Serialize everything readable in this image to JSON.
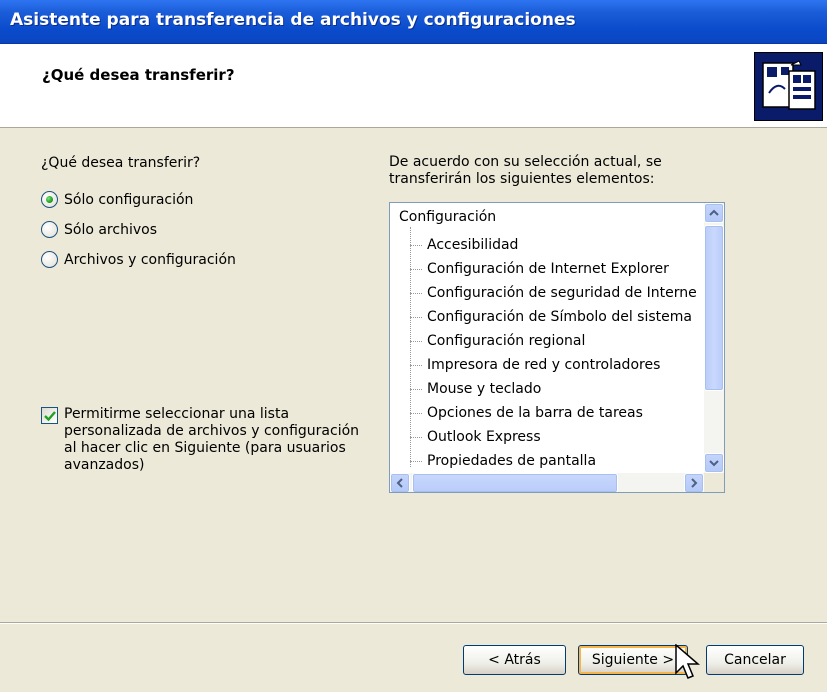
{
  "window": {
    "title": "Asistente para transferencia de archivos y configuraciones"
  },
  "header": {
    "title": "¿Qué desea transferir?",
    "icon": "transfer-wizard-icon"
  },
  "options": {
    "question": "¿Qué desea transferir?",
    "radios": [
      {
        "label": "Sólo configuración",
        "checked": true
      },
      {
        "label": "Sólo archivos",
        "checked": false
      },
      {
        "label": "Archivos y configuración",
        "checked": false
      }
    ]
  },
  "custom_list": {
    "checked": true,
    "label": "Permitirme seleccionar una lista personalizada de archivos y configuración al hacer clic en Siguiente (para usuarios avanzados)"
  },
  "summary": {
    "text": "De acuerdo con su selección actual, se transferirán los siguientes elementos:",
    "tree_root": "Configuración",
    "tree_items": [
      "Accesibilidad",
      "Configuración de Internet Explorer",
      "Configuración de seguridad de Interne",
      "Configuración de Símbolo del sistema",
      "Configuración regional",
      "Impresora de red y controladores",
      "Mouse y teclado",
      "Opciones de la barra de tareas",
      "Outlook Express",
      "Propiedades de pantalla"
    ]
  },
  "buttons": {
    "back": "< Atrás",
    "next": "Siguiente >",
    "cancel": "Cancelar"
  },
  "colors": {
    "titlebar": "#0A4BCB",
    "dialog_bg": "#ECE9D8",
    "default_button_focus": "#F8B349"
  }
}
